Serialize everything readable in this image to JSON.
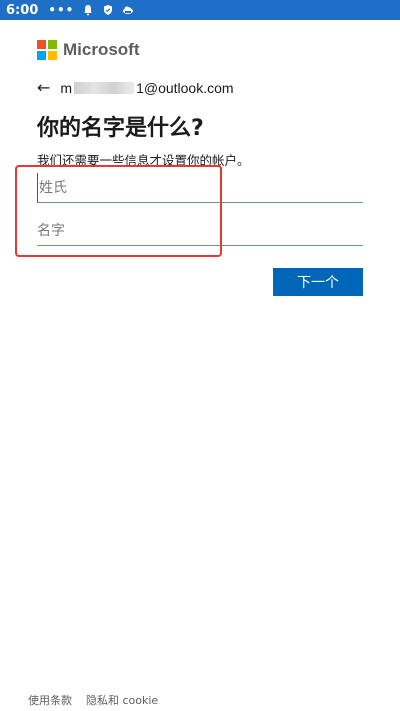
{
  "status_bar": {
    "time": "6:00",
    "dots": "•••",
    "icons": [
      "bell-icon",
      "shield-icon",
      "cloud-icon"
    ]
  },
  "brand": {
    "name": "Microsoft",
    "colors": [
      "#f25022",
      "#7fba00",
      "#00a4ef",
      "#ffb900"
    ]
  },
  "account": {
    "email_start": "m",
    "email_end": "1@outlook.com"
  },
  "page": {
    "title": "你的名字是什么?",
    "subtitle": "我们还需要一些信息才设置你的帐户。"
  },
  "form": {
    "surname_placeholder": "姓氏",
    "surname_value": "",
    "given_placeholder": "名字",
    "given_value": "",
    "next_label": "下一个"
  },
  "footer": {
    "terms": "使用条款",
    "privacy": "隐私和 cookie"
  },
  "colors": {
    "primary": "#0067b8",
    "statusbar": "#1f6fc6",
    "highlight": "#e53935"
  }
}
